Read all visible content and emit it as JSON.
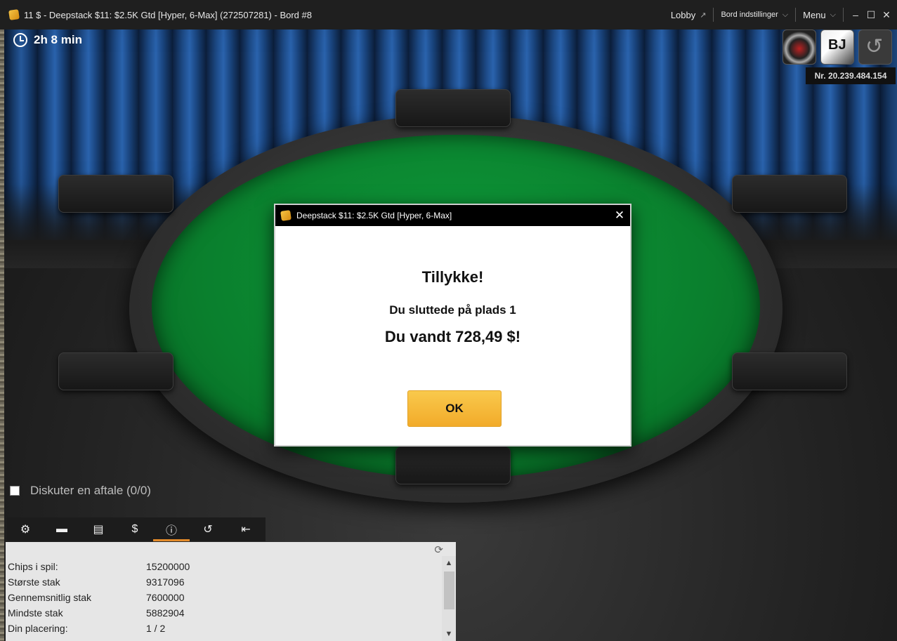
{
  "window": {
    "title": "11 $ - Deepstack $11: $2.5K Gtd [Hyper, 6-Max] (272507281) - Bord #8",
    "menu_lobby": "Lobby",
    "menu_lobby_icon": "↗",
    "menu_table_settings": "Bord indstillinger",
    "menu_menu": "Menu",
    "chevron": "⌵",
    "minimize": "–",
    "maximize": "☐",
    "close": "✕"
  },
  "hud": {
    "timer": "2h 8 min",
    "table_number": "Nr. 20.239.484.154",
    "replay_glyph": "↺",
    "blackjack_glyph": "BJ"
  },
  "dialog": {
    "title": "Deepstack $11: $2.5K Gtd [Hyper, 6-Max]",
    "close": "✕",
    "heading": "Tillykke!",
    "line1": "Du sluttede på plads 1",
    "line2": "Du vandt 728,49 $!",
    "ok": "OK"
  },
  "deal": {
    "label": "Diskuter en aftale (0/0)",
    "checked": false
  },
  "toolbar": {
    "icons": [
      "⚙",
      "▬",
      "▤",
      "$",
      "ⓘ",
      "↺",
      "⇤"
    ],
    "active_index": 4
  },
  "info": {
    "refresh": "⟳",
    "rows": [
      {
        "label": "Chips i spil:",
        "value": "15200000"
      },
      {
        "label": "Største stak",
        "value": "9317096"
      },
      {
        "label": "Gennemsnitlig stak",
        "value": "7600000"
      },
      {
        "label": "Mindste stak",
        "value": "5882904"
      },
      {
        "label": "Din placering:",
        "value": "1 / 2"
      }
    ],
    "scroll_up": "▲",
    "scroll_down": "▼"
  },
  "colors": {
    "felt": "#0a7f2d",
    "ok_button": "#f2ab2a",
    "active_tab": "#e38b2a"
  }
}
